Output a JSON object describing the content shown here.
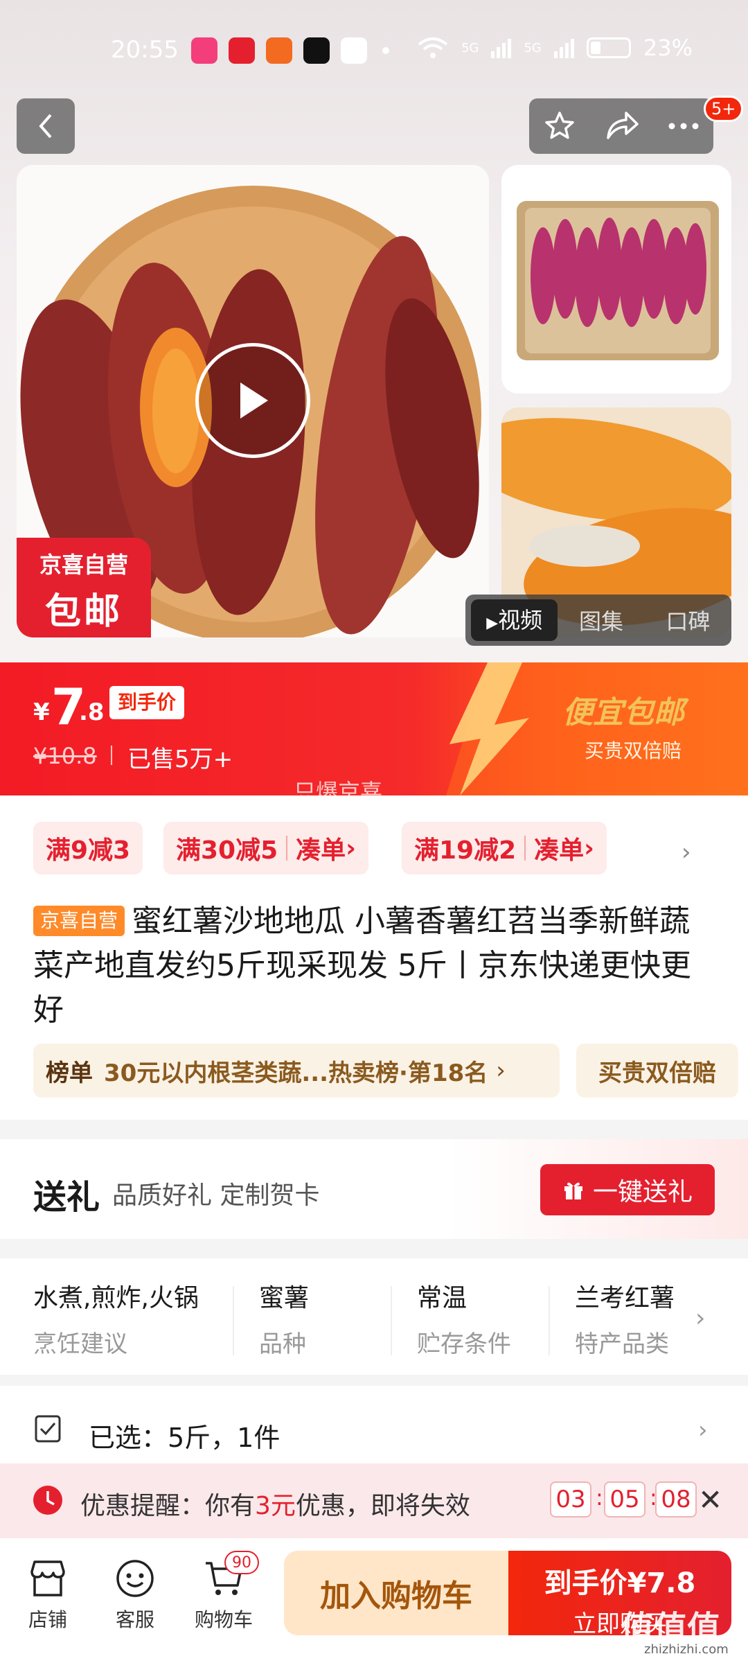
{
  "status_bar": {
    "time": "20:55",
    "network": "5G",
    "network2": "5G",
    "battery": "23%"
  },
  "header": {
    "cart_badge": "5+"
  },
  "gallery": {
    "self_op_tag": "京喜自营",
    "free_ship_tag": "包邮",
    "tabs": [
      "视频",
      "图集",
      "口碑"
    ]
  },
  "price": {
    "currency": "¥",
    "integer": "7",
    "decimal": ".8",
    "price_tag": "到手价",
    "original": "¥10.8",
    "sold": "已售5万+",
    "slogan": "便宜包邮",
    "slogan_sub": "买贵双倍赔",
    "watermark": "只爆京喜"
  },
  "coupons": [
    {
      "label": "满9减3"
    },
    {
      "label": "满30减5",
      "action": "凑单"
    },
    {
      "label": "满19减2",
      "action": "凑单"
    }
  ],
  "product": {
    "tag": "京喜自营",
    "title": "蜜红薯沙地地瓜 小薯香薯红苕当季新鲜蔬菜产地直发约5斤现采现发 5斤丨京东快递更快更好"
  },
  "rank": {
    "label": "榜单",
    "detail": "30元以内根茎类蔬...热卖榜·第18名",
    "extra": "买贵双倍赔"
  },
  "gift": {
    "title": "送礼",
    "subtitle": "品质好礼 定制贺卡",
    "button": "一键送礼"
  },
  "attributes": [
    {
      "value": "水煮,煎炸,火锅",
      "key": "烹饪建议"
    },
    {
      "value": "蜜薯",
      "key": "品种"
    },
    {
      "value": "常温",
      "key": "贮存条件"
    },
    {
      "value": "兰考红薯",
      "key": "特产品类"
    }
  ],
  "selection": {
    "text": "已选：5斤，1件"
  },
  "reminder": {
    "prefix": "优惠提醒：你有",
    "amount": "3元",
    "suffix": "优惠，即将失效",
    "h": "03",
    "m": "05",
    "s": "08"
  },
  "bottom_bar": {
    "store": "店铺",
    "service": "客服",
    "cart": "购物车",
    "cart_count": "90",
    "add_to_cart": "加入购物车",
    "buy_price": "到手价¥7.8",
    "buy_now": "立即购买"
  },
  "watermark": {
    "site": "值值值",
    "url": "zhizhizhi.com"
  },
  "colors": {
    "accent": "#e4202f",
    "orange": "#ff7a1f",
    "gold": "#f2c35a"
  }
}
